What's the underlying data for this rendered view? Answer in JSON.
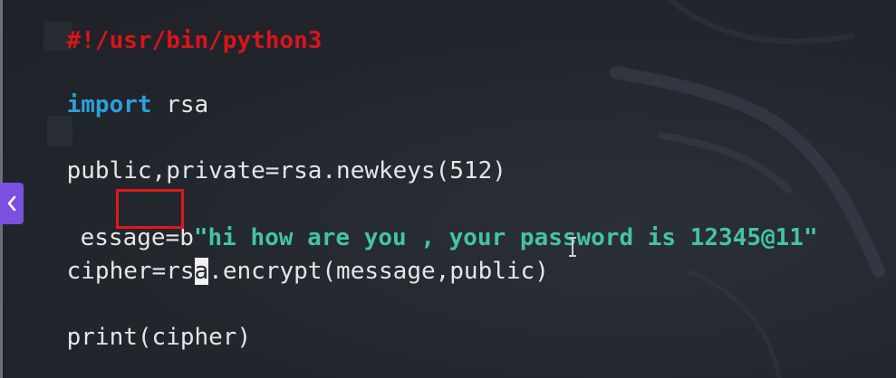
{
  "editor": {
    "lines": {
      "shebang": "#!/usr/bin/python3",
      "import_keyword": "import",
      "import_module": " rsa",
      "keys_line": "public,private=rsa.newkeys(512)",
      "message_prefix": "essage=b",
      "message_string": "\"hi how are you , your password is 12345@11\"",
      "cipher_before_cursor": "cipher=rs",
      "cipher_cursor_char": "a",
      "cipher_after_cursor": ".encrypt(message,public)",
      "print_line": "print(cipher)"
    },
    "colors": {
      "background": "#23272f",
      "text": "#e6e6e6",
      "shebang": "#d9141a",
      "keyword": "#2d9fd8",
      "string": "#43c4a4",
      "highlight_box": "#e3161c",
      "nav_button": "#7b4fe0"
    }
  },
  "icons": {
    "prev_button": "chevron-left-icon",
    "text_cursor": "i-beam-cursor-icon"
  }
}
